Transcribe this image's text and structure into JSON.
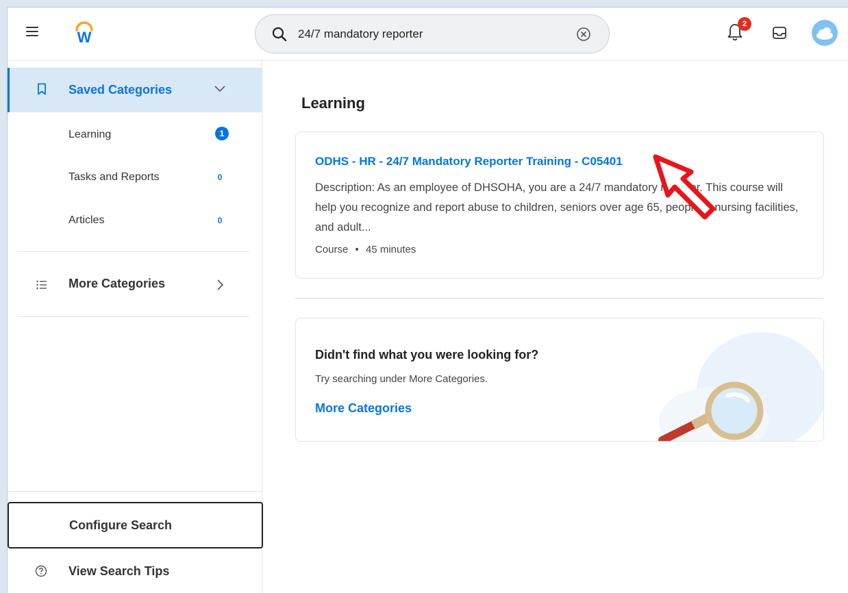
{
  "header": {
    "search_value": "24/7 mandatory reporter",
    "notification_count": "2"
  },
  "sidebar": {
    "saved_label": "Saved Categories",
    "items": [
      {
        "label": "Learning",
        "count": "1"
      },
      {
        "label": "Tasks and Reports",
        "count": "0"
      },
      {
        "label": "Articles",
        "count": "0"
      }
    ],
    "more_label": "More Categories",
    "configure_label": "Configure Search",
    "tips_label": "View Search Tips"
  },
  "main": {
    "section_title": "Learning",
    "result": {
      "title": "ODHS - HR - 24/7 Mandatory Reporter Training - C05401",
      "description": "Description: As an employee of DHSOHA, you are a 24/7 mandatory reporter. This course will help you recognize and report abuse to children, seniors over age 65, people in nursing facilities, and adult...",
      "type": "Course",
      "separator": "•",
      "duration": "45 minutes"
    },
    "help": {
      "heading": "Didn't find what you were looking for?",
      "subtext": "Try searching under More Categories.",
      "link": "More Categories"
    }
  },
  "colors": {
    "accent": "#0875e1",
    "selected_bg": "#d9e8f7",
    "badge_red": "#de2e21",
    "annotation_red": "#e8151b"
  }
}
